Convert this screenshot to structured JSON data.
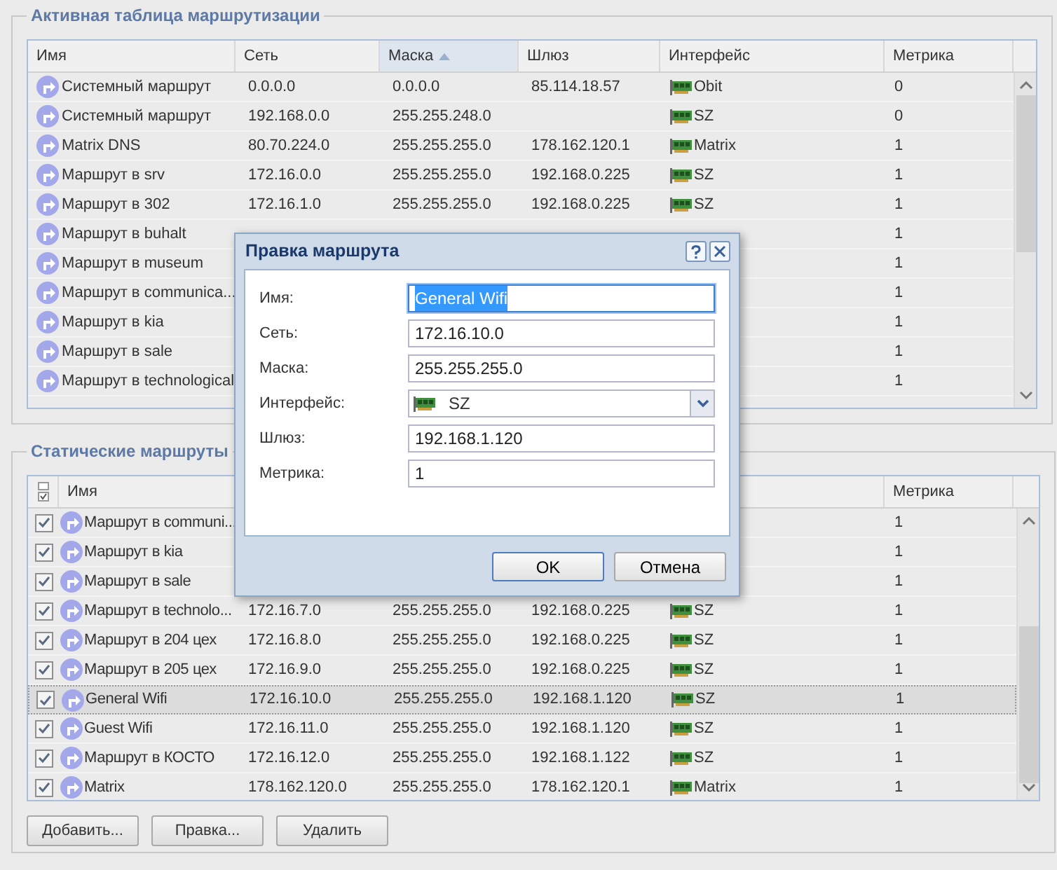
{
  "active_routes": {
    "title": "Активная таблица маршрутизации",
    "columns": [
      {
        "label": "Имя",
        "sorted": false
      },
      {
        "label": "Сеть",
        "sorted": false
      },
      {
        "label": "Маска",
        "sorted": true
      },
      {
        "label": "Шлюз",
        "sorted": false
      },
      {
        "label": "Интерфейс",
        "sorted": false
      },
      {
        "label": "Метрика",
        "sorted": false
      }
    ],
    "rows": [
      {
        "name": "Системный маршрут",
        "network": "0.0.0.0",
        "mask": "0.0.0.0",
        "gateway": "85.114.18.57",
        "interface": "Obit",
        "metric": "0"
      },
      {
        "name": "Системный маршрут",
        "network": "192.168.0.0",
        "mask": "255.255.248.0",
        "interface": "SZ",
        "metric": "0"
      },
      {
        "name": "Matrix DNS",
        "network": "80.70.224.0",
        "mask": "255.255.255.0",
        "gateway": "178.162.120.1",
        "interface": "Matrix",
        "metric": "1"
      },
      {
        "name": "Маршрут в srv",
        "network": "172.16.0.0",
        "mask": "255.255.255.0",
        "gateway": "192.168.0.225",
        "interface": "SZ",
        "metric": "1"
      },
      {
        "name": "Маршрут в 302",
        "network": "172.16.1.0",
        "mask": "255.255.255.0",
        "gateway": "192.168.0.225",
        "interface": "SZ",
        "metric": "1"
      },
      {
        "name": "Маршрут в buhalt",
        "metric": "1"
      },
      {
        "name": "Маршрут в museum",
        "metric": "1"
      },
      {
        "name": "Маршрут в communica...",
        "metric": "1"
      },
      {
        "name": "Маршрут в kia",
        "metric": "1"
      },
      {
        "name": "Маршрут в sale",
        "metric": "1"
      },
      {
        "name": "Маршрут в technological",
        "metric": "1"
      }
    ]
  },
  "static_routes": {
    "title": "Статические маршруты",
    "columns": [
      {
        "label": "Имя"
      },
      {},
      {},
      {},
      {},
      {
        "label": "Метрика"
      }
    ],
    "rows": [
      {
        "checked": true,
        "selected": false,
        "name": "Маршрут в communi...",
        "metric": "1"
      },
      {
        "checked": true,
        "selected": false,
        "name": "Маршрут в kia",
        "metric": "1"
      },
      {
        "checked": true,
        "selected": false,
        "name": "Маршрут в sale",
        "metric": "1"
      },
      {
        "checked": true,
        "selected": false,
        "name": "Маршрут в technolo...",
        "network": "172.16.7.0",
        "mask": "255.255.255.0",
        "gateway": "192.168.0.225",
        "interface": "SZ",
        "metric": "1"
      },
      {
        "checked": true,
        "selected": false,
        "name": "Маршрут в 204 цех",
        "network": "172.16.8.0",
        "mask": "255.255.255.0",
        "gateway": "192.168.0.225",
        "interface": "SZ",
        "metric": "1"
      },
      {
        "checked": true,
        "selected": false,
        "name": "Маршрут в 205 цех",
        "network": "172.16.9.0",
        "mask": "255.255.255.0",
        "gateway": "192.168.0.225",
        "interface": "SZ",
        "metric": "1"
      },
      {
        "checked": true,
        "selected": true,
        "name": "General Wifi",
        "network": "172.16.10.0",
        "mask": "255.255.255.0",
        "gateway": "192.168.1.120",
        "interface": "SZ",
        "metric": "1"
      },
      {
        "checked": true,
        "selected": false,
        "name": "Guest Wifi",
        "network": "172.16.11.0",
        "mask": "255.255.255.0",
        "gateway": "192.168.1.120",
        "interface": "SZ",
        "metric": "1"
      },
      {
        "checked": true,
        "selected": false,
        "name": "Маршрут в КОСТО",
        "network": "172.16.12.0",
        "mask": "255.255.255.0",
        "gateway": "192.168.1.122",
        "interface": "SZ",
        "metric": "1"
      },
      {
        "checked": true,
        "selected": false,
        "name": "Matrix",
        "network": "178.162.120.0",
        "mask": "255.255.255.0",
        "gateway": "178.162.120.1",
        "interface": "Matrix",
        "metric": "1"
      }
    ],
    "buttons": [
      "Добавить...",
      "Правка...",
      "Удалить"
    ]
  },
  "dialog": {
    "title": "Правка маршрута",
    "fields": [
      {
        "kind": "text",
        "label": "Имя:",
        "value": "General Wifi",
        "focused": true
      },
      {
        "kind": "text",
        "label": "Сеть:",
        "value": "172.16.10.0",
        "focused": false
      },
      {
        "kind": "text",
        "label": "Маска:",
        "value": "255.255.255.0",
        "focused": false
      },
      {
        "kind": "select",
        "label": "Интерфейс:",
        "value": "SZ",
        "focused": false
      },
      {
        "kind": "text",
        "label": "Шлюз:",
        "value": "192.168.1.120",
        "focused": false
      },
      {
        "kind": "text",
        "label": "Метрика:",
        "value": "1",
        "focused": false
      }
    ],
    "buttons": [
      {
        "label": "OK",
        "default": true
      },
      {
        "label": "Отмена",
        "default": false
      }
    ]
  }
}
